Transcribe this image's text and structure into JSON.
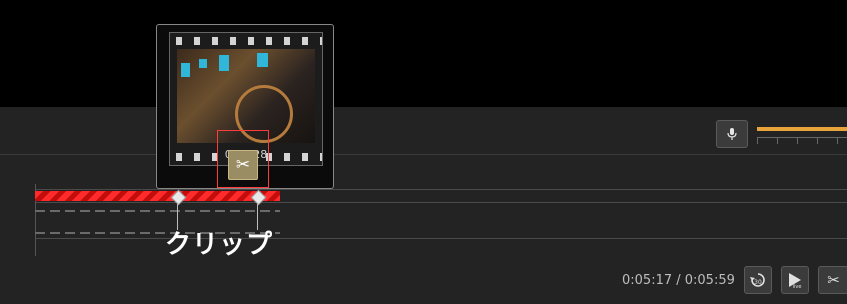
{
  "preview": {
    "timestamp": "0:05:28",
    "frame_icon": "film-frame-thumbnail"
  },
  "caption": "クリップ",
  "playback": {
    "time_readout": "0:05:17 / 0:05:59"
  },
  "controls": {
    "mic_icon": "microphone-icon",
    "scissor_icon": "scissors-icon",
    "rewind_label": "30",
    "record_label": "live"
  },
  "colors": {
    "clip": "#ff2a2a",
    "level": "#e8a33a",
    "highlight": "#ff3c3c"
  }
}
